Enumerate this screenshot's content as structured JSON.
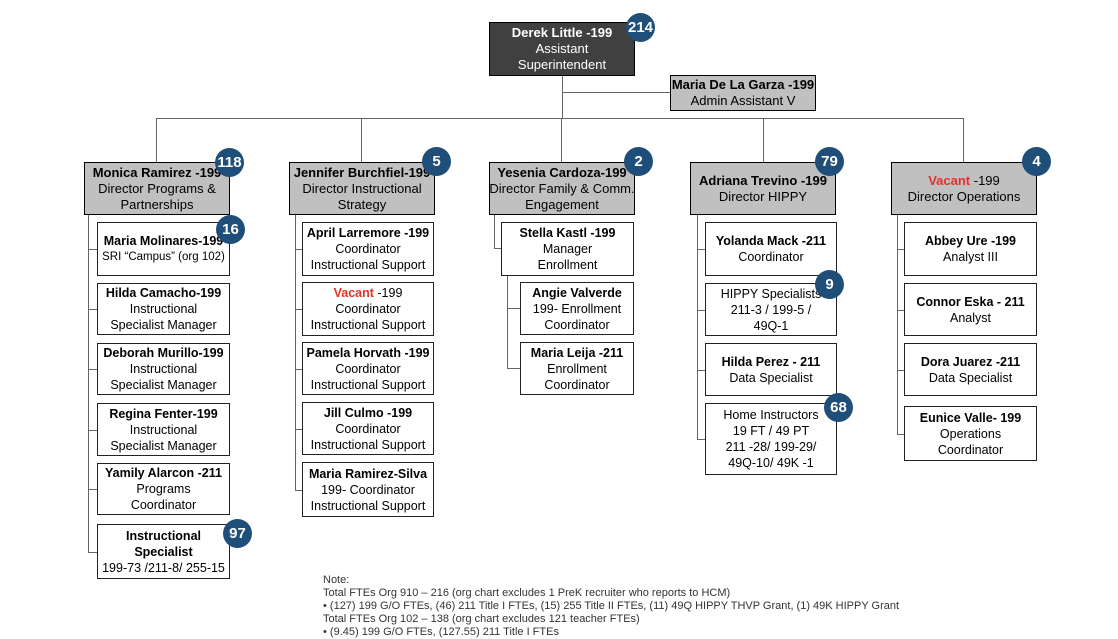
{
  "colors": {
    "badge": "#1f4e79",
    "vacant": "#e8302a",
    "director_fill": "#c0c0c0",
    "top_fill": "#404040"
  },
  "top": {
    "lines": [
      {
        "text": "Derek Little -199",
        "bold": true
      },
      {
        "text": "Assistant"
      },
      {
        "text": "Superintendent"
      }
    ],
    "badge": "214"
  },
  "assistant": {
    "lines": [
      {
        "text": "Maria De La Garza -199",
        "bold": true
      },
      {
        "text": "Admin Assistant V"
      }
    ]
  },
  "columns": [
    {
      "director": {
        "lines": [
          {
            "text": "Monica Ramirez -199",
            "bold": true
          },
          {
            "text": "Director Programs &"
          },
          {
            "text": "Partnerships"
          }
        ],
        "badge": "118"
      },
      "children": [
        {
          "lines": [
            {
              "text": "Maria Molinares-199",
              "bold": true
            },
            {
              "text": "SRI “Campus” (org 102)",
              "small": true
            }
          ],
          "badge": "16"
        },
        {
          "lines": [
            {
              "text": "Hilda Camacho-199",
              "bold": true
            },
            {
              "text": "Instructional"
            },
            {
              "text": "Specialist Manager"
            }
          ]
        },
        {
          "lines": [
            {
              "text": "Deborah Murillo-199",
              "bold": true
            },
            {
              "text": "Instructional"
            },
            {
              "text": "Specialist Manager"
            }
          ]
        },
        {
          "lines": [
            {
              "text": "Regina Fenter-199",
              "bold": true
            },
            {
              "text": "Instructional"
            },
            {
              "text": "Specialist Manager"
            }
          ]
        },
        {
          "lines": [
            {
              "text": "Yamily Alarcon -211",
              "bold": true
            },
            {
              "text": "Programs"
            },
            {
              "text": "Coordinator"
            }
          ]
        },
        {
          "lines": [
            {
              "text": "Instructional",
              "bold": true
            },
            {
              "text": "Specialist",
              "bold": true
            },
            {
              "text": "199-73 /211-8/ 255-15"
            }
          ],
          "badge": "97"
        }
      ]
    },
    {
      "director": {
        "lines": [
          {
            "text": "Jennifer Burchfiel-199",
            "bold": true
          },
          {
            "text": "Director Instructional"
          },
          {
            "text": "Strategy"
          }
        ],
        "badge": "5"
      },
      "children": [
        {
          "lines": [
            {
              "text": "April Larremore -199",
              "bold": true
            },
            {
              "text": "Coordinator"
            },
            {
              "text": "Instructional Support"
            }
          ]
        },
        {
          "lines": [
            {
              "prefix": "Vacant",
              "text": " -199"
            },
            {
              "text": "Coordinator"
            },
            {
              "text": "Instructional Support"
            }
          ]
        },
        {
          "lines": [
            {
              "text": "Pamela Horvath -199",
              "bold": true
            },
            {
              "text": "Coordinator"
            },
            {
              "text": "Instructional Support"
            }
          ]
        },
        {
          "lines": [
            {
              "text": "Jill Culmo -199",
              "bold": true
            },
            {
              "text": "Coordinator"
            },
            {
              "text": "Instructional Support"
            }
          ]
        },
        {
          "lines": [
            {
              "text": "Maria Ramirez-Silva",
              "bold": true
            },
            {
              "text": "199- Coordinator"
            },
            {
              "text": "Instructional Support"
            }
          ]
        }
      ]
    },
    {
      "director": {
        "lines": [
          {
            "text": "Yesenia Cardoza-199",
            "bold": true
          },
          {
            "text": "Director Family & Comm."
          },
          {
            "text": "Engagement"
          }
        ],
        "badge": "2"
      },
      "children": [
        {
          "lines": [
            {
              "text": "Stella Kastl -199",
              "bold": true
            },
            {
              "text": "Manager"
            },
            {
              "text": "Enrollment"
            }
          ]
        },
        {
          "lines": [
            {
              "text": "Angie Valverde",
              "bold": true
            },
            {
              "text": "199- Enrollment"
            },
            {
              "text": "Coordinator"
            }
          ]
        },
        {
          "lines": [
            {
              "text": "Maria Leija -211",
              "bold": true
            },
            {
              "text": "Enrollment"
            },
            {
              "text": "Coordinator"
            }
          ]
        }
      ]
    },
    {
      "director": {
        "lines": [
          {
            "text": "Adriana Trevino -199",
            "bold": true
          },
          {
            "text": "Director HIPPY"
          }
        ],
        "badge": "79"
      },
      "children": [
        {
          "lines": [
            {
              "text": "Yolanda Mack -211",
              "bold": true
            },
            {
              "text": "Coordinator"
            }
          ]
        },
        {
          "lines": [
            {
              "text": "HIPPY Specialists"
            },
            {
              "text": "211-3 / 199-5 /"
            },
            {
              "text": "49Q-1"
            }
          ],
          "badge": "9"
        },
        {
          "lines": [
            {
              "text": "Hilda Perez - 211",
              "bold": true
            },
            {
              "text": "Data Specialist"
            }
          ]
        },
        {
          "lines": [
            {
              "text": "Home Instructors"
            },
            {
              "text": "19 FT / 49 PT"
            },
            {
              "text": "211 -28/ 199-29/"
            },
            {
              "text": "49Q-10/ 49K -1"
            }
          ],
          "badge": "68"
        }
      ]
    },
    {
      "director": {
        "lines": [
          {
            "prefix": "Vacant",
            "text": " -199"
          },
          {
            "text": "Director Operations"
          }
        ],
        "badge": "4"
      },
      "children": [
        {
          "lines": [
            {
              "text": "Abbey Ure -199",
              "bold": true
            },
            {
              "text": "Analyst III"
            }
          ]
        },
        {
          "lines": [
            {
              "text": "Connor Eska - 211",
              "bold": true
            },
            {
              "text": "Analyst"
            }
          ]
        },
        {
          "lines": [
            {
              "text": "Dora Juarez -211",
              "bold": true
            },
            {
              "text": "Data Specialist"
            }
          ]
        },
        {
          "lines": [
            {
              "text": "Eunice Valle- 199",
              "bold": true
            },
            {
              "text": "Operations"
            },
            {
              "text": "Coordinator"
            }
          ]
        }
      ]
    }
  ],
  "note": {
    "lines": [
      "Note:",
      "Total FTEs Org 910 – 216 (org chart excludes 1 PreK recruiter who reports to HCM)",
      "• (127) 199 G/O FTEs, (46) 211 Title I FTEs,  (15) 255 Title II FTEs, (11) 49Q HIPPY THVP Grant, (1) 49K HIPPY Grant",
      "Total FTEs Org 102 – 138 (org chart excludes 121 teacher FTEs)",
      "• (9.45) 199 G/O FTEs, (127.55) 211 Title I FTEs"
    ]
  }
}
